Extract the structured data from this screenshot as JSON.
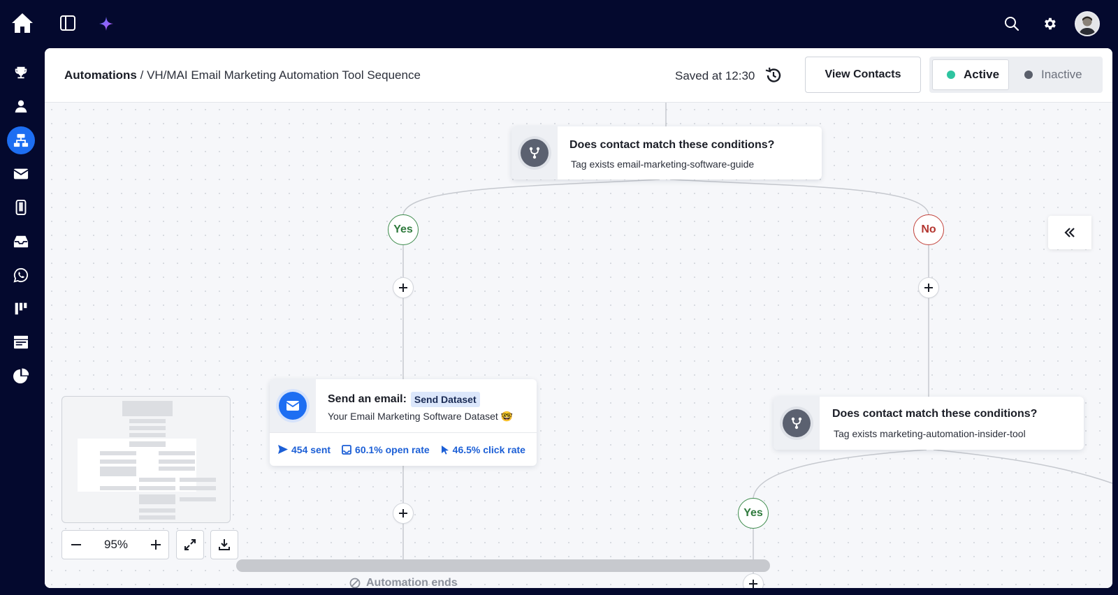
{
  "topbar": {
    "icons": [
      "home-icon",
      "sidebar-toggle-icon",
      "sparkle-icon",
      "search-icon",
      "gear-icon",
      "avatar"
    ]
  },
  "nav": {
    "items": [
      "trophy-icon",
      "contacts-icon",
      "automations-icon",
      "email-icon",
      "mobile-icon",
      "inbox-icon",
      "whatsapp-icon",
      "pipeline-icon",
      "landing-page-icon",
      "reports-icon"
    ],
    "active": "automations-icon"
  },
  "header": {
    "breadcrumb_root": "Automations",
    "breadcrumb_separator": " / ",
    "breadcrumb_current": "VH/MAI Email Marketing Automation Tool Sequence",
    "saved_text": "Saved at 12:30",
    "view_contacts_label": "View Contacts",
    "status_active_label": "Active",
    "status_inactive_label": "Inactive",
    "active_color": "#2ec4a0",
    "inactive_color": "#5a5f6b"
  },
  "flow": {
    "condition_1": {
      "title": "Does contact match these conditions?",
      "subtitle": "Tag exists email-marketing-software-guide"
    },
    "branch_yes_label": "Yes",
    "branch_no_label": "No",
    "email_step": {
      "title": "Send an email:",
      "tag": "Send Dataset",
      "subtitle": "Your Email Marketing Software Dataset 🤓",
      "sent": "454 sent",
      "open_rate": "60.1% open rate",
      "click_rate": "46.5% click rate"
    },
    "condition_2": {
      "title": "Does contact match these conditions?",
      "subtitle": "Tag exists marketing-automation-insider-tool"
    },
    "branch_yes_2_label": "Yes",
    "automation_ends_label": "Automation ends"
  },
  "controls": {
    "zoom_level": "95%"
  },
  "colors": {
    "brand_blue": "#1d6ef2",
    "nav_bg": "#04092e",
    "yes_green": "#2f7a3d",
    "no_red": "#b3352f"
  }
}
